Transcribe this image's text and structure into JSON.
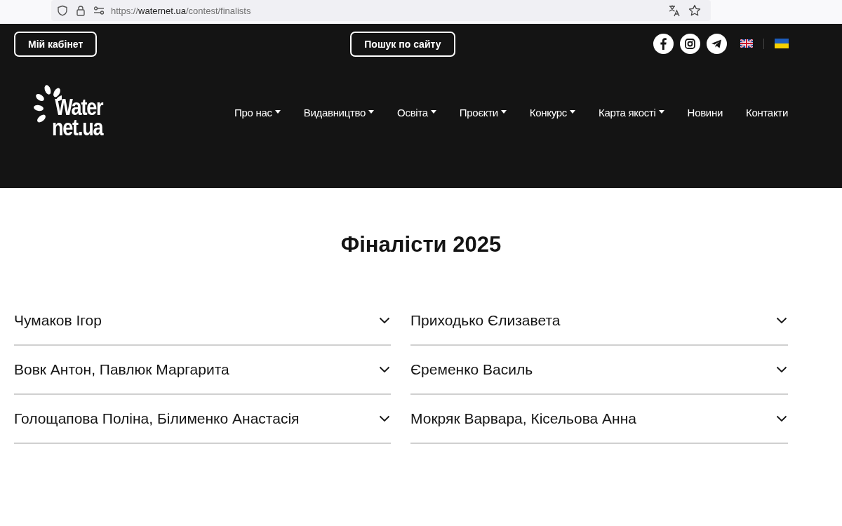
{
  "browser": {
    "url": {
      "scheme": "https://",
      "host": "waternet.ua",
      "path": "/contest/finalists"
    }
  },
  "header": {
    "cabinet_button": "Мій кабінет",
    "search_button": "Пошук по сайту",
    "social": [
      {
        "kind": "facebook"
      },
      {
        "kind": "instagram"
      },
      {
        "kind": "telegram"
      }
    ],
    "languages": [
      {
        "kind": "en"
      },
      {
        "kind": "uk"
      }
    ],
    "logo": {
      "line_1": "Water",
      "line_2": "net.ua"
    },
    "nav": [
      {
        "label": "Про нас",
        "has_dropdown": true
      },
      {
        "label": "Видавництво",
        "has_dropdown": true
      },
      {
        "label": "Освіта",
        "has_dropdown": true
      },
      {
        "label": "Проєкти",
        "has_dropdown": true
      },
      {
        "label": "Конкурс",
        "has_dropdown": true
      },
      {
        "label": "Карта якості",
        "has_dropdown": true
      },
      {
        "label": "Новини",
        "has_dropdown": false
      },
      {
        "label": "Контакти",
        "has_dropdown": false
      }
    ]
  },
  "title": "Фіналісти 2025",
  "finalists": [
    {
      "name": "Чумаков Ігор",
      "expanded": false
    },
    {
      "name": "Приходько Єлизавета",
      "expanded": false
    },
    {
      "name": "Вовк Антон, Павлюк Маргарита",
      "expanded": false
    },
    {
      "name": "Єременко Василь",
      "expanded": false
    },
    {
      "name": "Голощапова Поліна, Білименко Анастасія",
      "expanded": false
    },
    {
      "name": "Мокряк Варвара, Кісельова Анна",
      "expanded": false
    }
  ]
}
